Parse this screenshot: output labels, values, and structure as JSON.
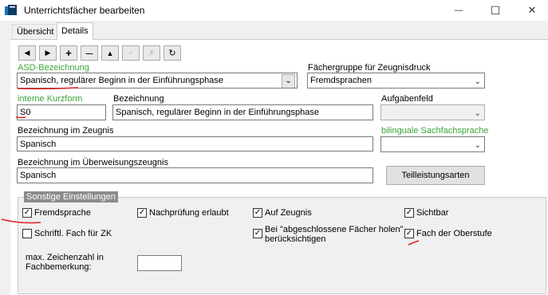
{
  "window": {
    "title": "Unterrichtsfächer bearbeiten",
    "minimize": "—",
    "maximize": "☐",
    "close": "✕"
  },
  "tabs": [
    {
      "label": "Übersicht"
    },
    {
      "label": "Details"
    }
  ],
  "nav": {
    "first": "◀",
    "prev": "▶",
    "add": "+",
    "remove": "—",
    "up": "▲",
    "confirm": "✓",
    "cancel": "✗",
    "refresh": "↻"
  },
  "fields": {
    "asd_label": "ASD-Bezeichnung",
    "asd_value": "Spanisch, regulärer Beginn in der Einführungsphase",
    "faechergruppe_label": "Fächergruppe für Zeugnisdruck",
    "faechergruppe_value": "Fremdsprachen",
    "kurzform_label": "interne Kurzform",
    "kurzform_value": "S0",
    "bezeichnung_label": "Bezeichnung",
    "bezeichnung_value": "Spanisch, regulärer Beginn in der Einführungsphase",
    "aufgabenfeld_label": "Aufgabenfeld",
    "aufgabenfeld_value": "",
    "zeugnis_label": "Bezeichnung im Zeugnis",
    "zeugnis_value": "Spanisch",
    "bilingual_label": "bilinguale Sachfachsprache",
    "bilingual_value": "",
    "ueberweisung_label": "Bezeichnung im Überweisungszeugnis",
    "ueberweisung_value": "Spanisch",
    "teilleistung_button": "Teilleistungsarten"
  },
  "settings": {
    "legend": "Sonstige Einstellungen",
    "fremdsprache": {
      "label": "Fremdsprache",
      "checked": true
    },
    "nachpruefung": {
      "label": "Nachprüfung erlaubt",
      "checked": true
    },
    "auf_zeugnis": {
      "label": "Auf Zeugnis",
      "checked": true
    },
    "sichtbar": {
      "label": "Sichtbar",
      "checked": true
    },
    "schriftl": {
      "label": "Schriftl. Fach für ZK",
      "checked": false
    },
    "abgeschlossen": {
      "label_line1": "Bei \"abgeschlossene Fächer holen\"",
      "label_line2": "berücksichtigen",
      "checked": true
    },
    "oberstufe": {
      "label": "Fach der Oberstufe",
      "checked": true
    },
    "max_zeichen_label_line1": "max. Zeichenzahl in",
    "max_zeichen_label_line2": "Fachbemerkung:",
    "max_zeichen_value": ""
  },
  "colors": {
    "green_label": "#3aa33a",
    "annotation_red": "#e02020"
  }
}
